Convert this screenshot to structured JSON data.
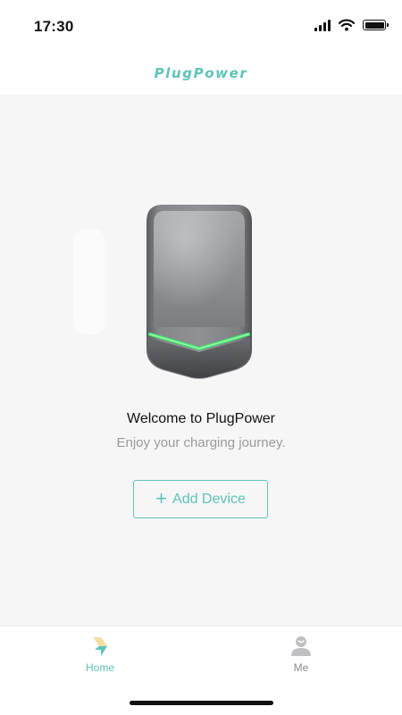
{
  "status_bar": {
    "time": "17:30",
    "icons": [
      "signal-icon",
      "wifi-icon",
      "battery-icon"
    ]
  },
  "header": {
    "logo_text": "PlugPower"
  },
  "main": {
    "device_image": "charger-device-image",
    "welcome_title": "Welcome to PlugPower",
    "tagline": "Enjoy your charging journey.",
    "add_device_label": "Add Device",
    "add_device_icon": "plus-icon"
  },
  "tab_bar": {
    "tabs": [
      {
        "label": "Home",
        "icon": "home-bolt-icon",
        "active": true
      },
      {
        "label": "Me",
        "icon": "user-icon",
        "active": false
      }
    ]
  },
  "colors": {
    "accent": "#5ec3b8",
    "background": "#f6f6f6",
    "led_green": "#3fe86a",
    "inactive_tab": "#8a8a8a"
  }
}
